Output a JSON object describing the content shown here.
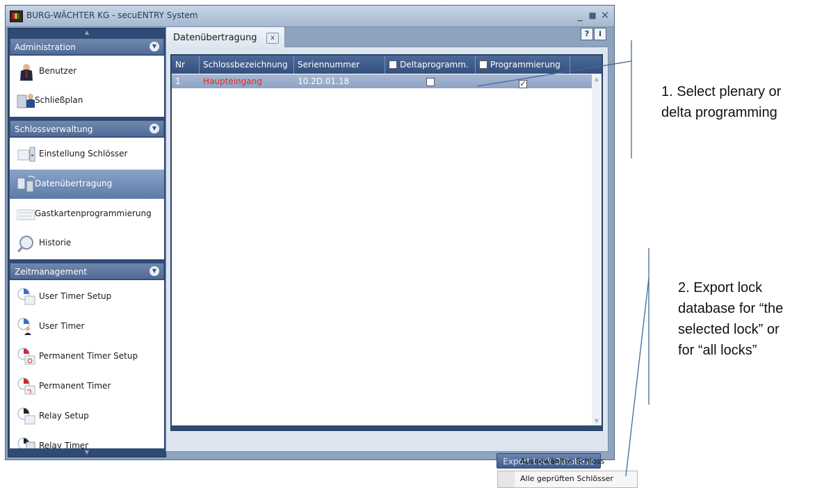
{
  "window": {
    "title": "BURG-WÄCHTER KG - secuENTRY System",
    "controls": {
      "minimize": "_",
      "maximize": "■",
      "close": "✕"
    }
  },
  "sidebar": {
    "scroll_up": "▲",
    "scroll_down": "▼",
    "groups": [
      {
        "title": "Administration",
        "toggle": "▼",
        "items": [
          {
            "label": "Benutzer",
            "icon": "user-icon"
          },
          {
            "label": "Schließplan",
            "icon": "locking-plan-icon"
          }
        ]
      },
      {
        "title": "Schlossverwaltung",
        "toggle": "▼",
        "items": [
          {
            "label": "Einstellung Schlösser",
            "icon": "lock-settings-icon"
          },
          {
            "label": "Datenübertragung",
            "icon": "data-transfer-icon",
            "selected": true
          },
          {
            "label": "Gastkartenprogrammierung",
            "icon": "guest-card-icon"
          },
          {
            "label": "Historie",
            "icon": "history-icon"
          }
        ]
      },
      {
        "title": "Zeitmanagement",
        "toggle": "▼",
        "items": [
          {
            "label": "User Timer Setup",
            "icon": "timer-setup-icon"
          },
          {
            "label": "User Timer",
            "icon": "user-timer-icon"
          },
          {
            "label": "Permanent Timer Setup",
            "icon": "permanent-timer-setup-icon"
          },
          {
            "label": "Permanent Timer",
            "icon": "permanent-timer-icon"
          },
          {
            "label": "Relay Setup",
            "icon": "relay-setup-icon"
          },
          {
            "label": "Relay Timer",
            "icon": "relay-timer-icon"
          }
        ]
      }
    ]
  },
  "tab": {
    "label": "Datenübertragung",
    "close": "x"
  },
  "help_buttons": {
    "help": "?",
    "info": "i"
  },
  "table": {
    "columns": [
      "Nr",
      "Schlossbezeichnung",
      "Seriennummer",
      "Deltaprogramm.",
      "Programmierung"
    ],
    "rows": [
      {
        "nr": "1",
        "name": "Haupteingang",
        "serial": "10.2D.01.18",
        "delta": false,
        "programming": true
      }
    ],
    "checkmark": "✓",
    "name_color": "#e8281e"
  },
  "export": {
    "button_label": "Export Lock Database",
    "menu": [
      "Ausgewähltes Schloss",
      "Alle geprüften Schlösser"
    ]
  },
  "annotations": {
    "a1": [
      "1. Select plenary or",
      "delta programming"
    ],
    "a2": [
      "2. Export lock",
      "database for “the",
      "selected lock” or",
      "for “all locks”"
    ]
  }
}
